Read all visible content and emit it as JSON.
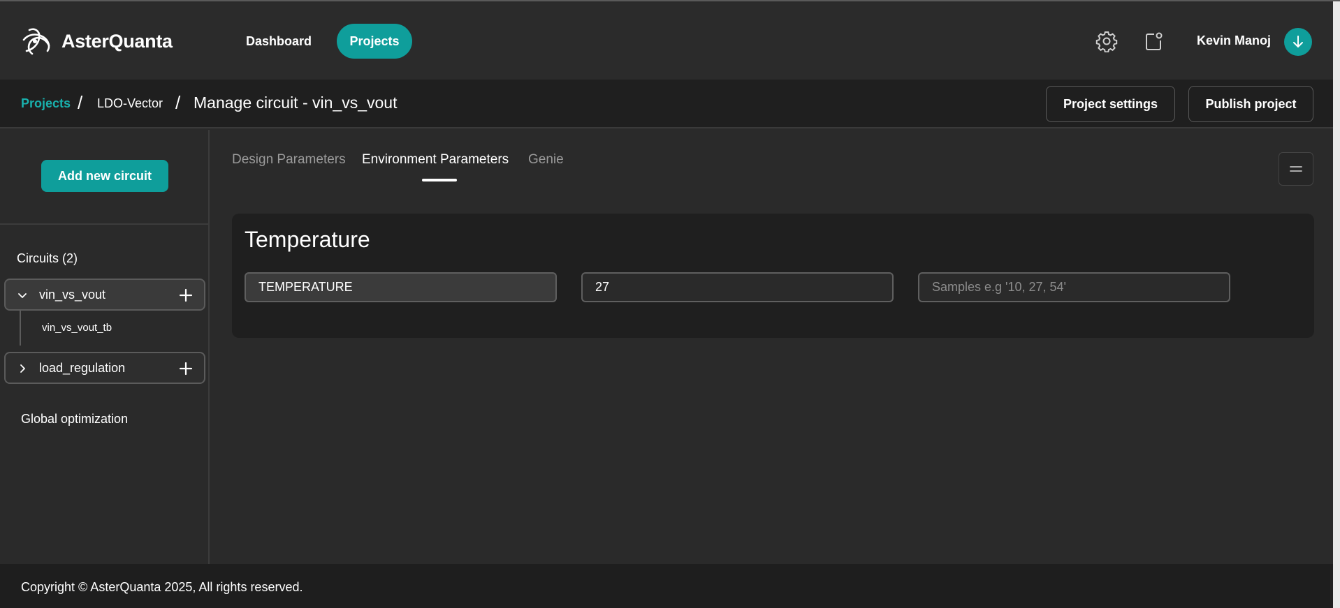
{
  "brand": {
    "name": "AsterQuanta",
    "accent": "#0f9e9b"
  },
  "nav": {
    "dashboard": "Dashboard",
    "projects": "Projects"
  },
  "header": {
    "user_name": "Kevin Manoj",
    "icons": [
      "settings-gear-icon",
      "notification-icon",
      "download-icon"
    ]
  },
  "breadcrumb": {
    "projects": "Projects",
    "separator": "/",
    "project": "LDO-Vector",
    "current": "Manage circuit - vin_vs_vout"
  },
  "actions": {
    "project_settings": "Project settings",
    "publish_project": "Publish project"
  },
  "sidebar": {
    "add_circuit": "Add new circuit",
    "circuits_heading": "Circuits (2)",
    "circuits": [
      {
        "label": "vin_vs_vout",
        "expanded": true,
        "children": [
          "vin_vs_vout_tb"
        ]
      },
      {
        "label": "load_regulation",
        "expanded": false,
        "children": []
      }
    ],
    "global_optimization": "Global optimization"
  },
  "tabs": [
    {
      "label": "Design Parameters",
      "active": false
    },
    {
      "label": "Environment Parameters",
      "active": true
    },
    {
      "label": "Genie",
      "active": false
    }
  ],
  "temperature": {
    "title": "Temperature",
    "name_value": "TEMPERATURE",
    "value": "27",
    "samples_placeholder": "Samples e.g '10, 27, 54'",
    "samples_value": ""
  },
  "footer": {
    "copyright": "Copyright © AsterQuanta 2025, All rights reserved."
  }
}
